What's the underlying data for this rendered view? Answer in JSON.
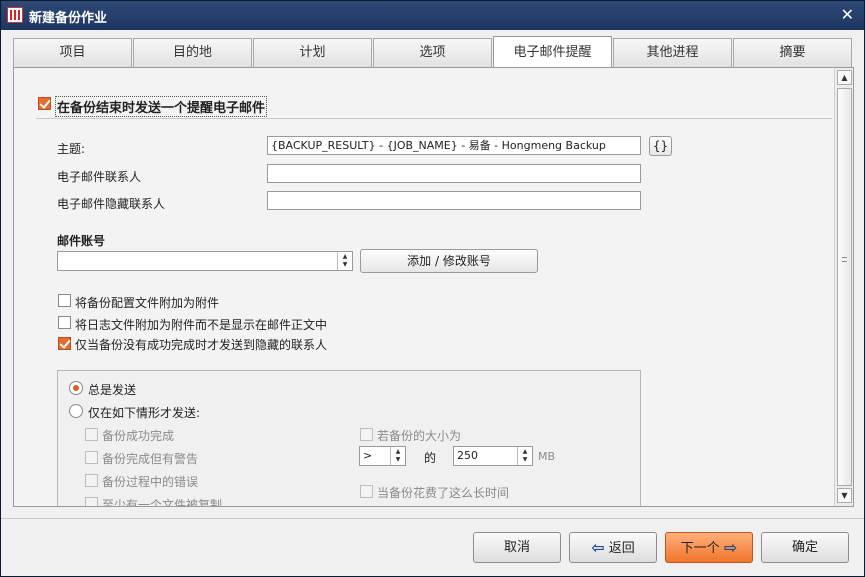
{
  "window": {
    "title": "新建备份作业",
    "close_glyph": "✕"
  },
  "tabs": [
    {
      "label": "项目"
    },
    {
      "label": "目的地"
    },
    {
      "label": "计划"
    },
    {
      "label": "选项"
    },
    {
      "label": "电子邮件提醒"
    },
    {
      "label": "其他进程"
    },
    {
      "label": "摘要"
    }
  ],
  "active_tab": "电子邮件提醒",
  "email": {
    "enable_label": "在备份结束时发送一个提醒电子邮件",
    "enabled": true,
    "subject_label": "主题:",
    "subject_value": "{BACKUP_RESULT} - {JOB_NAME} - 易备 - Hongmeng Backup",
    "macro_button": "{}",
    "to_label": "电子邮件联系人",
    "to_value": "",
    "bcc_label": "电子邮件隐藏联系人",
    "bcc_value": ""
  },
  "account": {
    "section_label": "邮件账号",
    "selected": "",
    "add_button": "添加 / 修改账号"
  },
  "options": [
    {
      "label": "将备份配置文件附加为附件",
      "checked": false
    },
    {
      "label": "将日志文件附加为附件而不是显示在邮件正文中",
      "checked": false
    },
    {
      "label": "仅当备份没有成功完成时才发送到隐藏的联系人",
      "checked": true
    }
  ],
  "send_mode": {
    "always_label": "总是发送",
    "conditional_label": "仅在如下情形才发送:",
    "selected": "always"
  },
  "conditions": {
    "success": "备份成功完成",
    "warnings": "备份完成但有警告",
    "errors": "备份过程中的错误",
    "partial": "至少有一个文件被复制",
    "size_label": "若备份的大小为",
    "size_operator": ">",
    "size_of": "的",
    "size_value": "250",
    "size_unit": "MB",
    "time_label": "当备份花费了这么长时间"
  },
  "footer": {
    "cancel": "取消",
    "back": "返回",
    "next": "下一个",
    "ok": "确定"
  },
  "colors": {
    "accent": "#f0752c",
    "titlebar": "#1d3560",
    "check": "#e86a2c"
  }
}
